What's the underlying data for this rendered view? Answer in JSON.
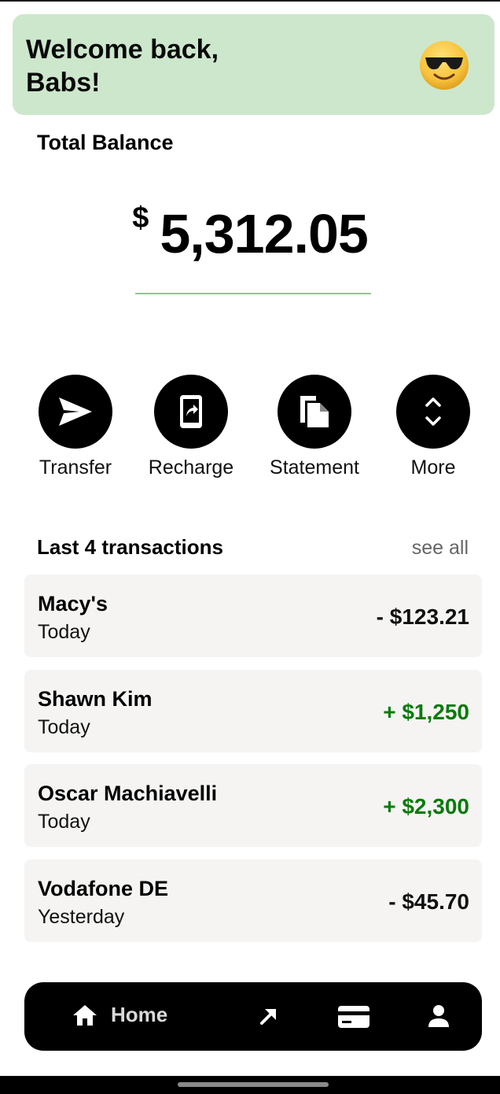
{
  "header": {
    "welcome": "Welcome back, Babs!",
    "emoji": "😎",
    "emoji_icon": "sunglasses-smiley-icon"
  },
  "balance": {
    "label": "Total Balance",
    "currency": "$",
    "amount": "5,312.05"
  },
  "actions": [
    {
      "label": "Transfer",
      "icon": "send-icon"
    },
    {
      "label": "Recharge",
      "icon": "recharge-phone-icon"
    },
    {
      "label": "Statement",
      "icon": "documents-icon"
    },
    {
      "label": "More",
      "icon": "expand-more-icon"
    }
  ],
  "transactions": {
    "title": "Last 4 transactions",
    "see_all": "see all",
    "items": [
      {
        "name": "Macy's",
        "date": "Today",
        "amount": "- $123.21",
        "type": "debit"
      },
      {
        "name": "Shawn Kim",
        "date": "Today",
        "amount": "+ $1,250",
        "type": "credit"
      },
      {
        "name": "Oscar Machiavelli",
        "date": "Today",
        "amount": "+ $2,300",
        "type": "credit"
      },
      {
        "name": "Vodafone DE",
        "date": "Yesterday",
        "amount": "- $45.70",
        "type": "debit"
      }
    ]
  },
  "nav": {
    "home_label": "Home",
    "items": [
      "home-icon",
      "arrow-up-right-icon",
      "credit-card-icon",
      "profile-icon"
    ]
  },
  "colors": {
    "welcome_bg": "#cde7cc",
    "credit": "#0a7a0a",
    "debit": "#111111",
    "card_bg": "#f5f4f3"
  }
}
